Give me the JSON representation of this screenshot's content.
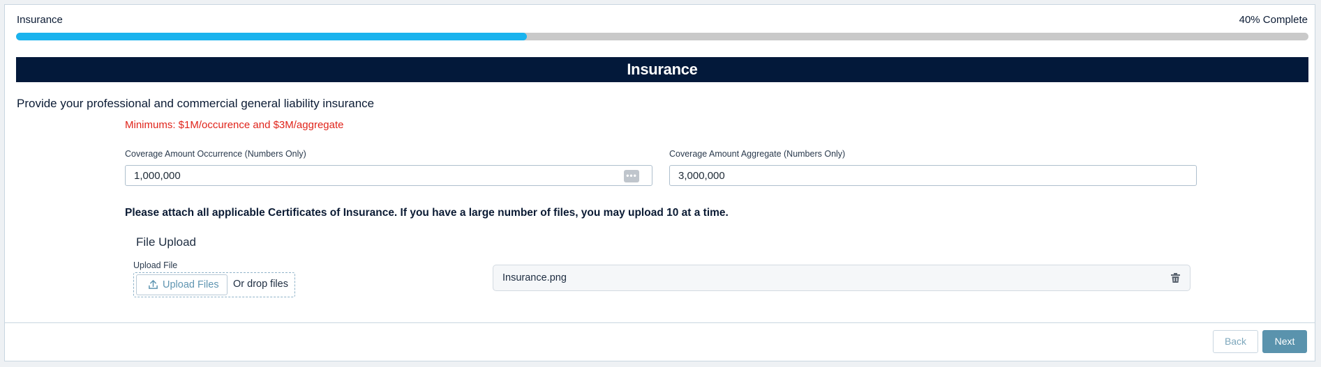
{
  "progress": {
    "title": "Insurance",
    "percent_label": "40% Complete",
    "fill_fraction": 0.395,
    "colors": {
      "fill": "#1ab3ee",
      "track": "#c9c9c9"
    }
  },
  "banner": {
    "title": "Insurance",
    "background": "#03193a"
  },
  "instructions": "Provide your professional and commercial general liability insurance",
  "minimums": "Minimums: $1M/occurence and $3M/aggregate",
  "fields": {
    "occurrence": {
      "label": "Coverage Amount Occurrence (Numbers Only)",
      "value": "1,000,000",
      "icon": "more-options-icon"
    },
    "aggregate": {
      "label": "Coverage Amount Aggregate (Numbers Only)",
      "value": "3,000,000"
    }
  },
  "attach_note": "Please attach all applicable Certificates of Insurance. If you have a large number of files, you may upload 10 at a time.",
  "upload": {
    "heading": "File Upload",
    "label": "Upload File",
    "button_label": "Upload Files",
    "drop_text": "Or drop files",
    "icon": "upload-icon"
  },
  "files": [
    {
      "name": "Insurance.png",
      "icon": "trash-icon"
    }
  ],
  "nav": {
    "back_label": "Back",
    "next_label": "Next",
    "accent": "#5a93ad"
  }
}
